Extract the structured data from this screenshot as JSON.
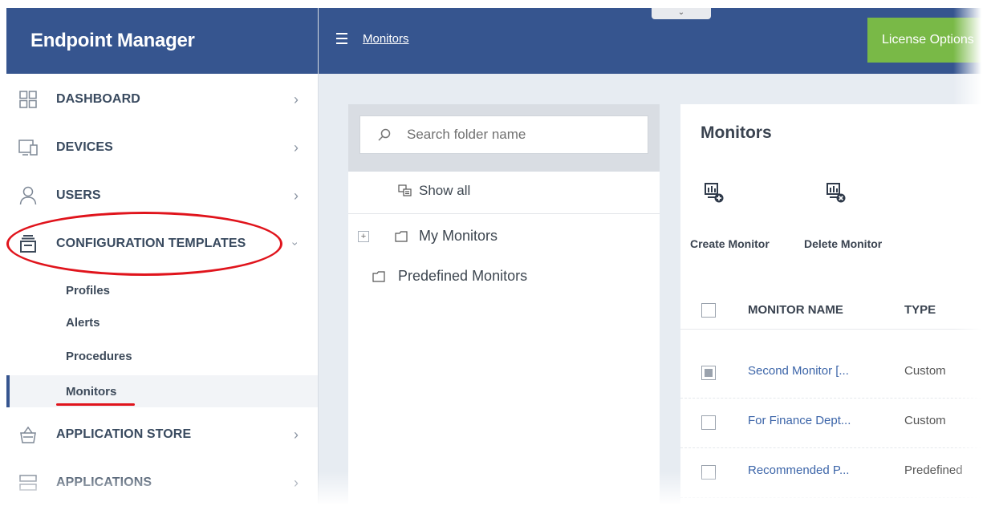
{
  "app": {
    "brand": "Endpoint Manager"
  },
  "topbar": {
    "breadcrumb": "Monitors",
    "collapse_glyph": "⌄",
    "license_label": "License Options",
    "license_color": "#79b947",
    "header_color": "#36558f"
  },
  "sidebar": {
    "items": [
      {
        "label": "DASHBOARD",
        "icon": "dashboard-grid-icon"
      },
      {
        "label": "DEVICES",
        "icon": "devices-icon"
      },
      {
        "label": "USERS",
        "icon": "user-icon"
      },
      {
        "label": "CONFIGURATION TEMPLATES",
        "icon": "configuration-templates-icon",
        "expanded": true
      },
      {
        "label": "APPLICATION STORE",
        "icon": "basket-icon"
      },
      {
        "label": "APPLICATIONS",
        "icon": "applications-icon"
      }
    ],
    "subitems": [
      {
        "label": "Profiles"
      },
      {
        "label": "Alerts"
      },
      {
        "label": "Procedures"
      },
      {
        "label": "Monitors",
        "active": true
      }
    ],
    "annotation_color": "#e0141c"
  },
  "folders": {
    "search_placeholder": "Search folder name",
    "show_all": "Show all",
    "tree": [
      {
        "label": "My Monitors",
        "expandable": true,
        "expand_glyph": "+"
      },
      {
        "label": "Predefined Monitors",
        "expandable": false
      }
    ]
  },
  "monitors": {
    "title": "Monitors",
    "toolbar": {
      "create": "Create Monitor",
      "delete": "Delete Monitor"
    },
    "columns": {
      "name": "MONITOR NAME",
      "type": "TYPE"
    },
    "rows": [
      {
        "name": "Second Monitor [...",
        "type": "Custom",
        "checked": true
      },
      {
        "name": "For Finance Dept...",
        "type": "Custom",
        "checked": false
      },
      {
        "name": "Recommended P...",
        "type": "Predefined",
        "checked": false
      }
    ]
  }
}
